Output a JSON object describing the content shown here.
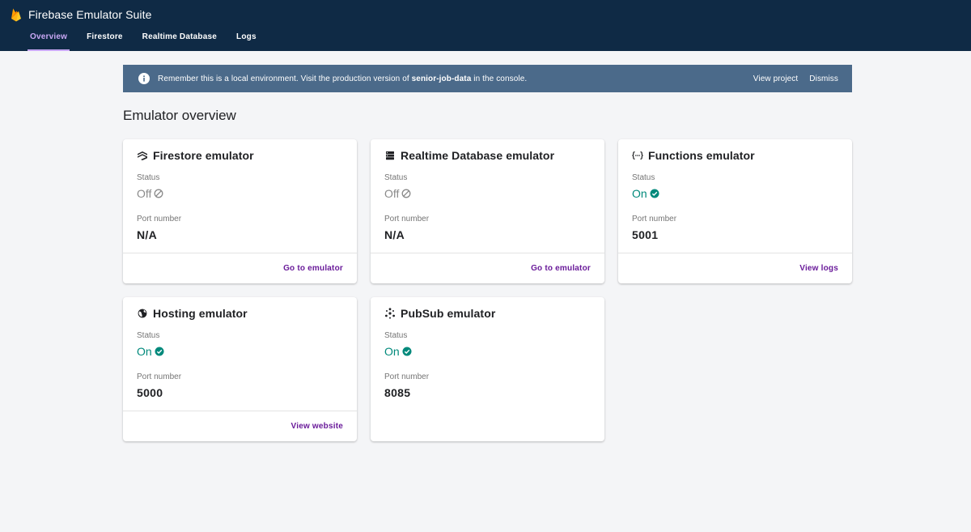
{
  "app": {
    "title": "Firebase Emulator Suite"
  },
  "tabs": [
    {
      "label": "Overview",
      "active": true
    },
    {
      "label": "Firestore"
    },
    {
      "label": "Realtime Database"
    },
    {
      "label": "Logs"
    }
  ],
  "banner": {
    "text_before": "Remember this is a local environment. Visit the production version of ",
    "project": "senior-job-data",
    "text_after": " in the console.",
    "view_project": "View project",
    "dismiss": "Dismiss"
  },
  "page_title": "Emulator overview",
  "cards": [
    {
      "title": "Firestore emulator",
      "icon": "firestore-icon",
      "status_label": "Status",
      "status": "Off",
      "port_label": "Port number",
      "port": "N/A",
      "link": "Go to emulator"
    },
    {
      "title": "Realtime Database emulator",
      "icon": "database-icon",
      "status_label": "Status",
      "status": "Off",
      "port_label": "Port number",
      "port": "N/A",
      "link": "Go to emulator"
    },
    {
      "title": "Functions emulator",
      "icon": "functions-icon",
      "status_label": "Status",
      "status": "On",
      "port_label": "Port number",
      "port": "5001",
      "link": "View logs"
    },
    {
      "title": "Hosting emulator",
      "icon": "globe-icon",
      "status_label": "Status",
      "status": "On",
      "port_label": "Port number",
      "port": "5000",
      "link": "View website"
    },
    {
      "title": "PubSub emulator",
      "icon": "pubsub-icon",
      "status_label": "Status",
      "status": "On",
      "port_label": "Port number",
      "port": "8085",
      "link": ""
    }
  ],
  "colors": {
    "topbar": "#0f2a45",
    "banner": "#4b6a8a",
    "accent_link": "#6a1b9a",
    "status_on": "#00897b",
    "status_off": "#8a8a8a",
    "active_tab": "#c9a8f5"
  }
}
